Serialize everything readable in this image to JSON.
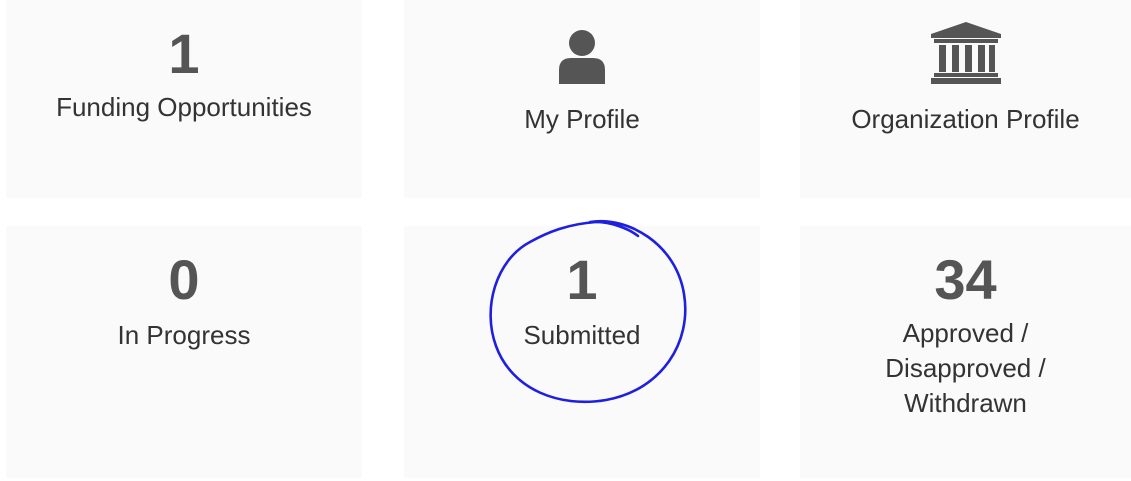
{
  "tiles": {
    "funding": {
      "count": "1",
      "label": "Funding Opportunities"
    },
    "my_profile": {
      "label": "My Profile",
      "icon": "user-icon"
    },
    "org_profile": {
      "label": "Organization Profile",
      "icon": "institution-icon"
    },
    "in_progress": {
      "count": "0",
      "label": "In Progress"
    },
    "submitted": {
      "count": "1",
      "label": "Submitted"
    },
    "approved": {
      "count": "34",
      "label": "Approved / Disapproved / Withdrawn"
    }
  },
  "annotation": {
    "type": "hand-drawn-circle",
    "color": "#1f1fe0"
  },
  "colors": {
    "tile_bg": "#fafafa",
    "count_text": "#555555",
    "label_text": "#333333",
    "icon": "#555555"
  }
}
